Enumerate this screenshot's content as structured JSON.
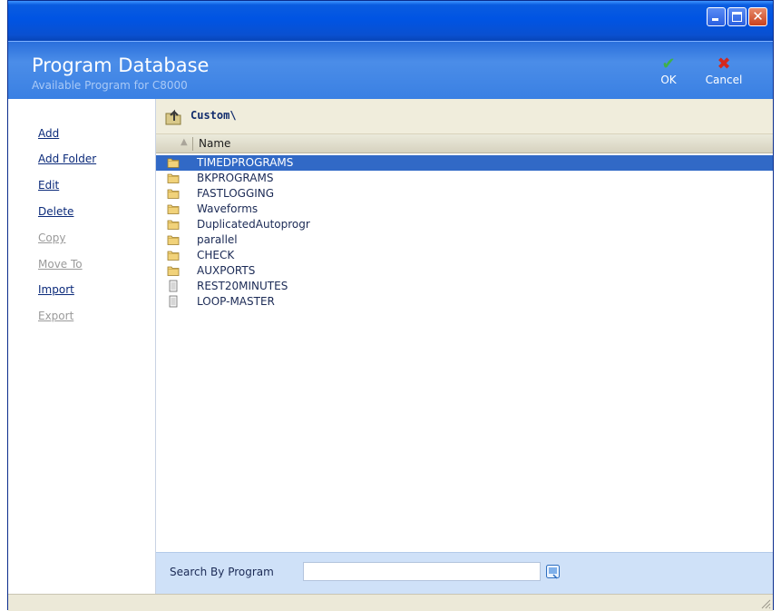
{
  "window": {
    "controls": {
      "minimize_icon": "minimize-icon",
      "maximize_icon": "maximize-icon",
      "close_icon": "close-icon",
      "close_glyph": "✕"
    }
  },
  "header": {
    "title": "Program Database",
    "subtitle": "Available Program for C8000",
    "ok_label": "OK",
    "ok_glyph": "✔",
    "cancel_label": "Cancel",
    "cancel_glyph": "✖"
  },
  "sidebar": {
    "actions": [
      {
        "label": "Add",
        "enabled": true
      },
      {
        "label": "Add Folder",
        "enabled": true
      },
      {
        "label": "Edit",
        "enabled": true
      },
      {
        "label": "Delete",
        "enabled": true
      },
      {
        "label": "Copy",
        "enabled": false
      },
      {
        "label": "Move To",
        "enabled": false
      },
      {
        "label": "Import",
        "enabled": true
      },
      {
        "label": "Export",
        "enabled": false
      }
    ]
  },
  "path": {
    "label": "Custom\\",
    "icon": "folder-up-icon"
  },
  "list": {
    "column_header": "Name",
    "sort_glyph": "▲",
    "items": [
      {
        "name": "TIMEDPROGRAMS",
        "type": "folder",
        "selected": true
      },
      {
        "name": "BKPROGRAMS",
        "type": "folder",
        "selected": false
      },
      {
        "name": "FASTLOGGING",
        "type": "folder",
        "selected": false
      },
      {
        "name": "Waveforms",
        "type": "folder",
        "selected": false
      },
      {
        "name": "DuplicatedAutoprogr",
        "type": "folder",
        "selected": false
      },
      {
        "name": "parallel",
        "type": "folder",
        "selected": false
      },
      {
        "name": "CHECK",
        "type": "folder",
        "selected": false
      },
      {
        "name": "AUXPORTS",
        "type": "folder",
        "selected": false
      },
      {
        "name": "REST20MINUTES",
        "type": "file",
        "selected": false
      },
      {
        "name": "LOOP-MASTER",
        "type": "file",
        "selected": false
      }
    ]
  },
  "search": {
    "label": "Search By Program",
    "value": "",
    "placeholder": ""
  },
  "colors": {
    "selection": "#3169c6",
    "header_blue": "#3a80e3",
    "ok_green": "#3fb04a",
    "cancel_red": "#d4281c"
  }
}
